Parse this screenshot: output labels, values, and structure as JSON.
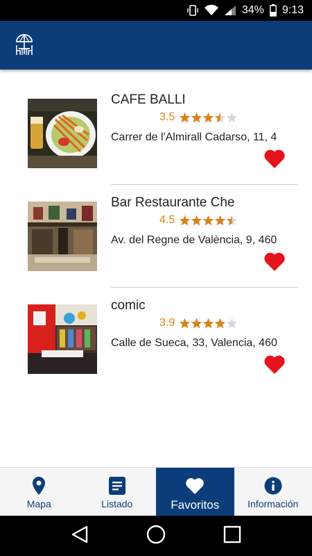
{
  "status_bar": {
    "battery": "34%",
    "time": "9:13"
  },
  "colors": {
    "primary": "#0b3d7a",
    "rating": "#d9821b",
    "star_empty": "#d8d8d8",
    "heart": "#e5131a"
  },
  "restaurants": [
    {
      "name": "CAFE BALLI",
      "rating": "3.5",
      "stars": 3.5,
      "address": "Carrer de l'Almirall Cadarso, 11, 4"
    },
    {
      "name": "Bar Restaurante Che",
      "rating": "4.5",
      "stars": 4.5,
      "address": "Av. del Regne de València, 9, 460"
    },
    {
      "name": "comic",
      "rating": "3.9",
      "stars": 3.9,
      "address": "Calle de Sueca, 33, Valencia, 460"
    }
  ],
  "bottom_nav": [
    {
      "label": "Mapa",
      "icon": "location-pin-icon"
    },
    {
      "label": "Listado",
      "icon": "list-icon"
    },
    {
      "label": "Favoritos",
      "icon": "heart-icon"
    },
    {
      "label": "Información",
      "icon": "info-icon"
    }
  ]
}
